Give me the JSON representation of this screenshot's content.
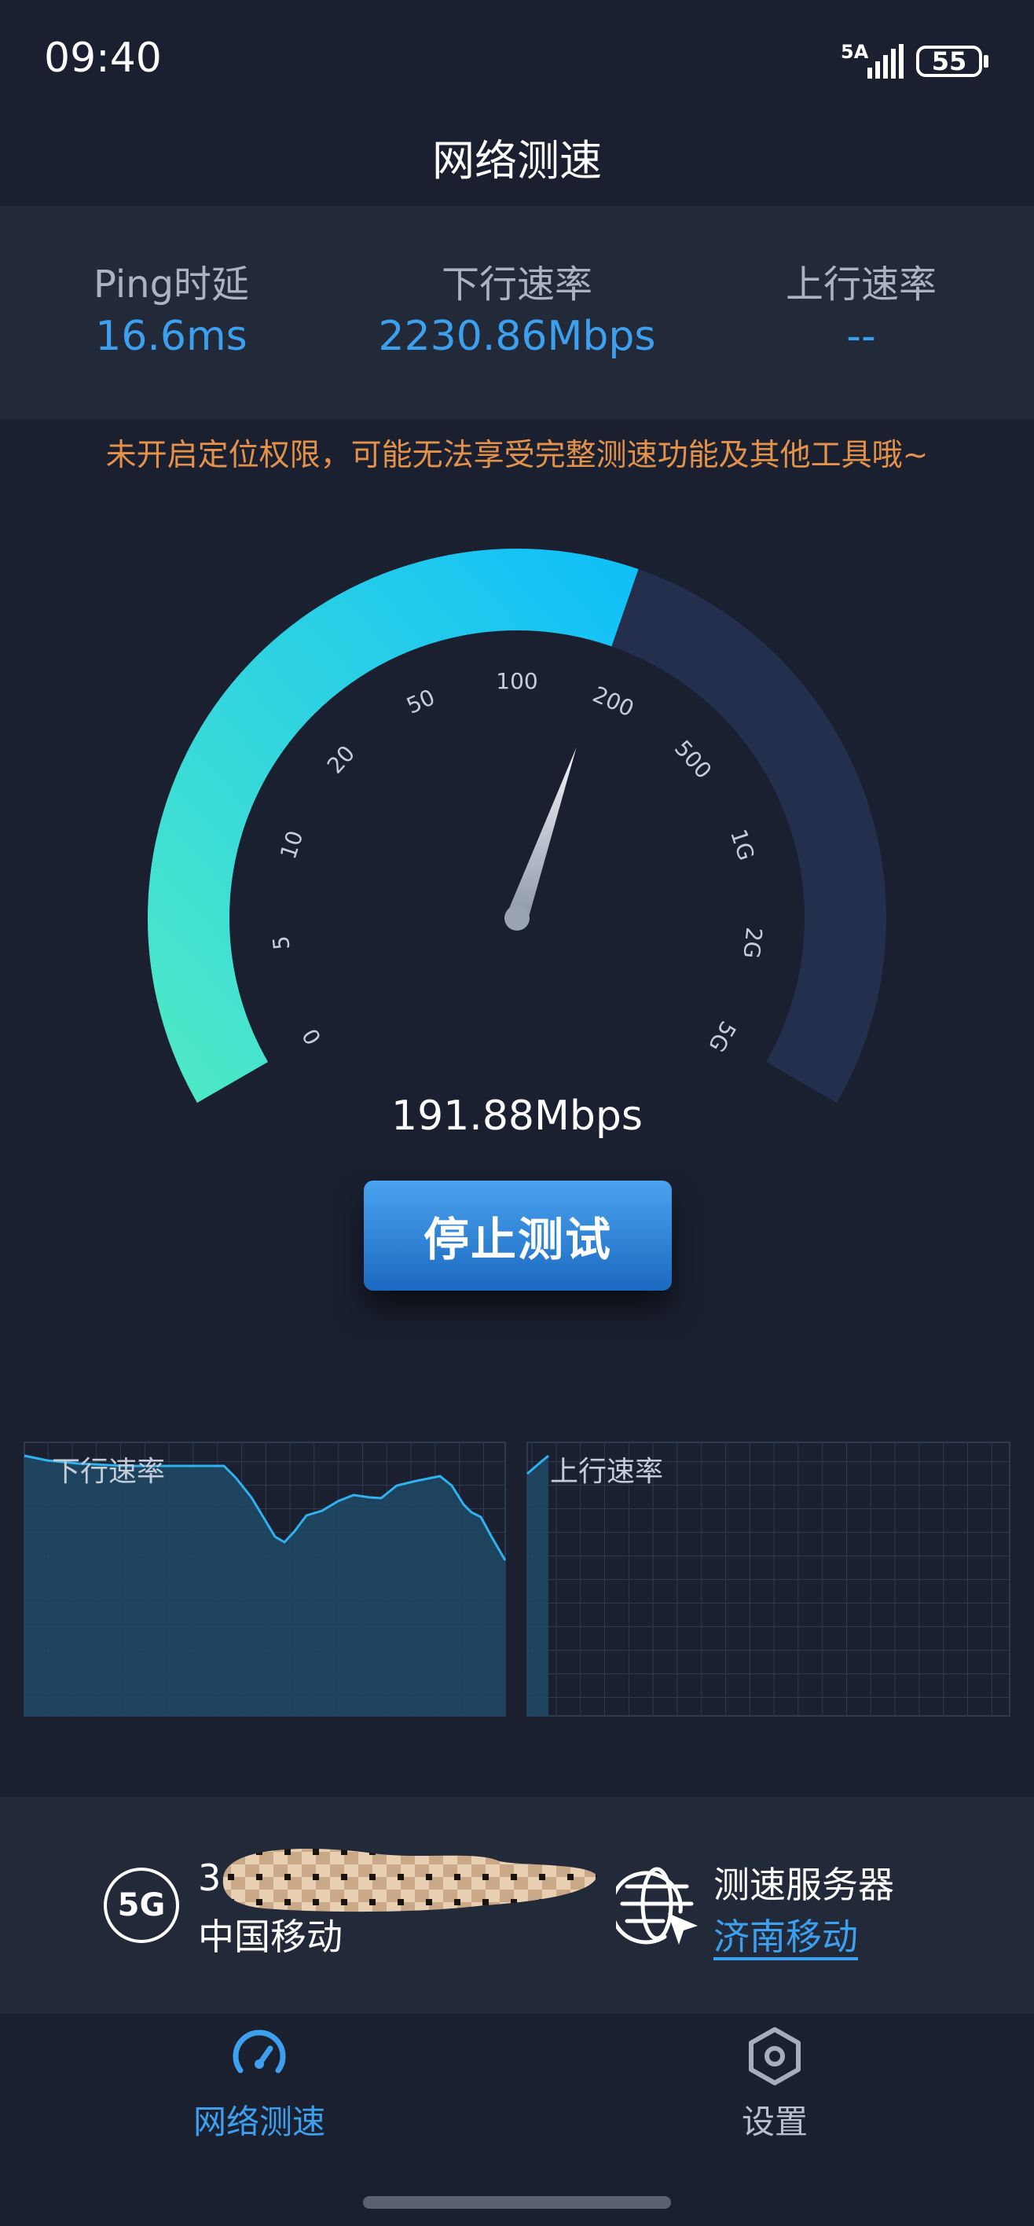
{
  "status_bar": {
    "time": "09:40",
    "network": "5A",
    "battery": "55"
  },
  "title": "网络测速",
  "stats": [
    {
      "label": "Ping时延",
      "value": "16.6ms"
    },
    {
      "label": "下行速率",
      "value": "2230.86Mbps"
    },
    {
      "label": "上行速率",
      "value": "--"
    }
  ],
  "warning": "未开启定位权限，可能无法享受完整测速功能及其他工具哦~",
  "gauge": {
    "tick_labels": [
      "0",
      "5",
      "10",
      "20",
      "50",
      "100",
      "200",
      "500",
      "1G",
      "2G",
      "5G"
    ],
    "current_speed": "191.88Mbps",
    "progress_fraction": 0.58
  },
  "stop_button": "停止测试",
  "charts": {
    "download_label": "下行速率",
    "upload_label": "上行速率"
  },
  "network_info": {
    "type_badge": "5G",
    "network_name_visible": "3",
    "carrier": "中国移动",
    "server_label": "测速服务器",
    "server_value": "济南移动"
  },
  "nav": [
    {
      "label": "网络测速",
      "icon": "speedometer-icon",
      "active": true
    },
    {
      "label": "设置",
      "icon": "settings-hexagon-icon",
      "active": false
    }
  ],
  "colors": {
    "background": "#1a2030",
    "panel": "#222938",
    "accent": "#3da0ee",
    "warning": "#e4924a",
    "gauge_start": "#4de8c8",
    "gauge_end": "#12c0f8",
    "gauge_track": "#232f4d"
  }
}
